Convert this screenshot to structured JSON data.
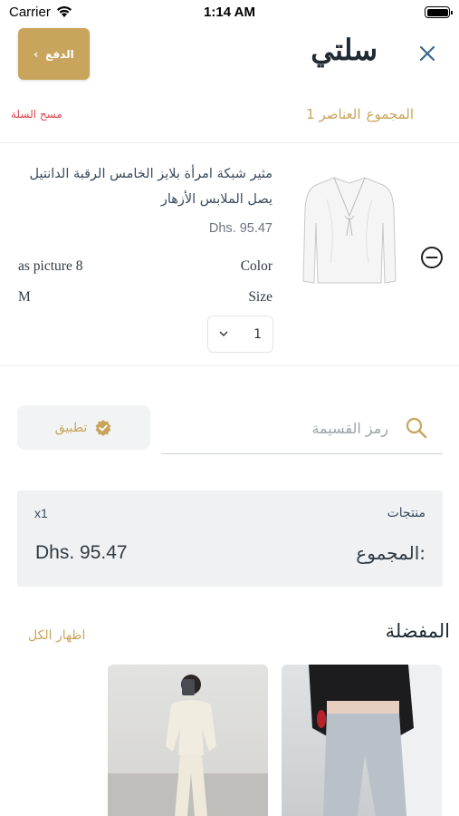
{
  "status_bar": {
    "carrier": "Carrier",
    "time": "1:14 AM"
  },
  "header": {
    "title": "سلتي",
    "pay_label": "الدفع",
    "close_icon": "close-icon"
  },
  "cart_meta": {
    "total_label": "المجموع",
    "total_items": "1 العناصر",
    "clear_label": "مسح السلة"
  },
  "product": {
    "name": "مثير شبكة امرأة بلايز الخامس الرقبة الدانتيل يصل الملابس الأزهار",
    "price": "Dhs.  95.47",
    "attributes": [
      {
        "label": "Color",
        "value": "as picture 8"
      },
      {
        "label": "Size",
        "value": "M"
      }
    ],
    "quantity": "1"
  },
  "coupon": {
    "placeholder": "رمز القسيمة",
    "apply_label": "تطبيق"
  },
  "summary": {
    "products_label": "منتجات",
    "count": "x1",
    "total_label": "المجموع:",
    "total_value": "Dhs.  95.47"
  },
  "favorites": {
    "title": "المفضلة",
    "show_all": "اظهار الكل"
  },
  "colors": {
    "accent": "#c9a45c",
    "danger": "#e0444e",
    "summary_bg": "#eff1f3"
  }
}
